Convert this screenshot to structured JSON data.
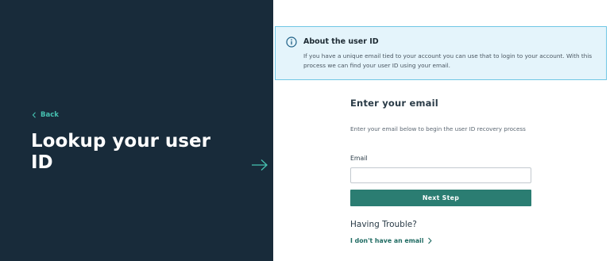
{
  "left_panel": {
    "back_label": "Back",
    "title": "Lookup your user ID",
    "background_color": "#182b3a",
    "accent_color": "#46c1b1",
    "arrow_icon": "arrow-right-icon"
  },
  "info_box": {
    "icon": "info-circle-icon",
    "title": "About the user ID",
    "body": "If you have a unique email tied to your account you can use that to login to your account. With this process we can find your user ID using your email.",
    "background_color": "#e4f4fb",
    "border_color": "#70c7e5"
  },
  "form": {
    "title": "Enter your email",
    "description": "Enter your email below to begin the user ID recovery process",
    "email_label": "Email",
    "email_value": "",
    "email_placeholder": "",
    "next_button_label": "Next Step",
    "button_color": "#2b7d72"
  },
  "help": {
    "heading": "Having Trouble?",
    "no_email_link": "I don't have an email"
  }
}
